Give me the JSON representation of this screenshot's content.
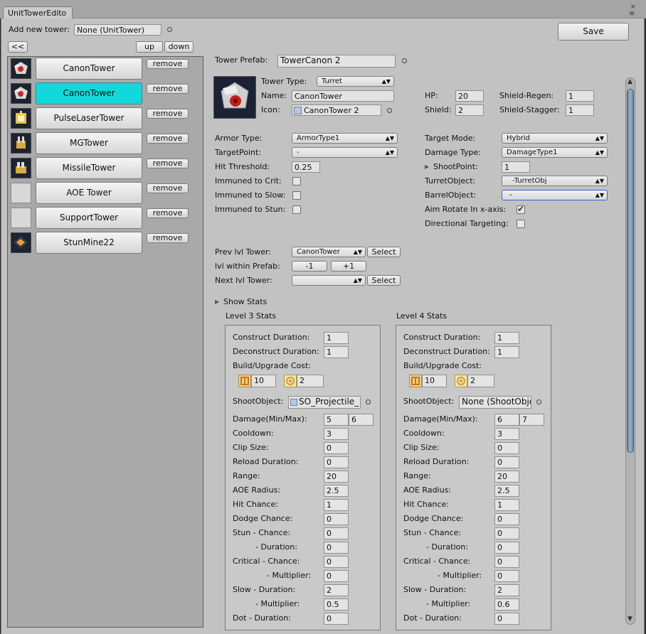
{
  "window": {
    "tab_title": "UnitTowerEdito",
    "close_glyph": "×",
    "menu_glyph": "≡"
  },
  "header": {
    "add_label": "Add new tower:",
    "add_value": "None (UnitTower)",
    "save_label": "Save",
    "back_label": "<<",
    "up_label": "up",
    "down_label": "down"
  },
  "tower_list": [
    {
      "name": "CanonTower",
      "icon": "canon-turret-icon",
      "selected": false,
      "remove": "remove"
    },
    {
      "name": "CanonTower",
      "icon": "canon-turret-icon",
      "selected": true,
      "remove": "remove"
    },
    {
      "name": "PulseLaserTower",
      "icon": "laser-turret-icon",
      "selected": false,
      "remove": "remove"
    },
    {
      "name": "MGTower",
      "icon": "mg-turret-icon",
      "selected": false,
      "remove": "remove"
    },
    {
      "name": "MissileTower",
      "icon": "missile-turret-icon",
      "selected": false,
      "remove": "remove"
    },
    {
      "name": "AOE Tower",
      "icon": "",
      "selected": false,
      "remove": "remove"
    },
    {
      "name": "SupportTower",
      "icon": "",
      "selected": false,
      "remove": "remove"
    },
    {
      "name": "StunMine22",
      "icon": "mine-icon",
      "selected": false,
      "remove": "remove"
    }
  ],
  "prefab": {
    "label": "Tower Prefab:",
    "value": "TowerCanon 2"
  },
  "basic": {
    "type_label": "Tower Type:",
    "type_value": "Turret",
    "name_label": "Name:",
    "name_value": "CanonTower",
    "icon_label": "Icon:",
    "icon_value": "CanonTower 2",
    "hp_label": "HP:",
    "hp_value": "20",
    "shield_label": "Shield:",
    "shield_value": "2",
    "regen_label": "Shield-Regen:",
    "regen_value": "1",
    "stagger_label": "Shield-Stagger:",
    "stagger_value": "1"
  },
  "combat": {
    "armor_label": "Armor Type:",
    "armor_value": "ArmorType1",
    "targetpoint_label": "TargetPoint:",
    "targetpoint_value": "-",
    "hit_label": "Hit Threshold:",
    "hit_value": "0.25",
    "crit_label": "Immuned to Crit:",
    "slow_label": "Immuned to Slow:",
    "stun_label": "Immuned to Stun:",
    "mode_label": "Target Mode:",
    "mode_value": "Hybrid",
    "damage_label": "Damage Type:",
    "damage_value": "DamageType1",
    "shootpoint_label": "ShootPoint:",
    "shootpoint_value": "1",
    "turret_label": "TurretObject:",
    "turret_value": "-TurretObj",
    "barrel_label": "BarrelObject:",
    "barrel_value": "-",
    "aim_label": "Aim Rotate In x-axis:",
    "dir_label": "Directional Targeting:",
    "crit_checked": false,
    "slow_checked": false,
    "stun_checked": false,
    "aim_checked": true,
    "dir_checked": false
  },
  "levels": {
    "prev_label": "Prev lvl Tower:",
    "prev_value": "CanonTower",
    "select_label": "Select",
    "within_label": "lvl within Prefab:",
    "minus_label": "-1",
    "plus_label": "+1",
    "next_label": "Next lvl Tower:",
    "next_value": ""
  },
  "show_stats_label": "Show Stats",
  "stat_labels": {
    "construct": "Construct Duration:",
    "deconstruct": "Deconstruct Duration:",
    "cost": "Build/Upgrade Cost:",
    "shootobject": "ShootObject:",
    "damage": "Damage(Min/Max):",
    "cooldown": "Cooldown:",
    "clip": "Clip Size:",
    "reload": "Reload Duration:",
    "range": "Range:",
    "aoe": "AOE Radius:",
    "hit": "Hit Chance:",
    "dodge": "Dodge Chance:",
    "stun_chance": "Stun  - Chance:",
    "stun_duration": "- Duration:",
    "crit_chance": "Critical  - Chance:",
    "crit_mult": "- Multiplier:",
    "slow_duration": "Slow   - Duration:",
    "slow_mult": "- Multiplier:",
    "dot_duration": "Dot   - Duration:"
  },
  "stats": [
    {
      "title": "Level 3 Stats",
      "construct": "1",
      "deconstruct": "1",
      "cost1": "10",
      "cost2": "2",
      "shootobject": "SO_Projectile_",
      "dmg_min": "5",
      "dmg_max": "6",
      "cooldown": "3",
      "clip": "0",
      "reload": "0",
      "range": "20",
      "aoe": "2.5",
      "hit": "1",
      "dodge": "0",
      "stun_chance": "0",
      "stun_duration": "0",
      "crit_chance": "0",
      "crit_mult": "0",
      "slow_duration": "2",
      "slow_mult": "0.5",
      "dot_duration": "0"
    },
    {
      "title": "Level 4 Stats",
      "construct": "1",
      "deconstruct": "1",
      "cost1": "10",
      "cost2": "2",
      "shootobject": "None (ShootObje",
      "dmg_min": "6",
      "dmg_max": "7",
      "cooldown": "3",
      "clip": "0",
      "reload": "0",
      "range": "20",
      "aoe": "2.5",
      "hit": "1",
      "dodge": "0",
      "stun_chance": "0",
      "stun_duration": "0",
      "crit_chance": "0",
      "crit_mult": "0",
      "slow_duration": "2",
      "slow_mult": "0.6",
      "dot_duration": "0"
    }
  ]
}
